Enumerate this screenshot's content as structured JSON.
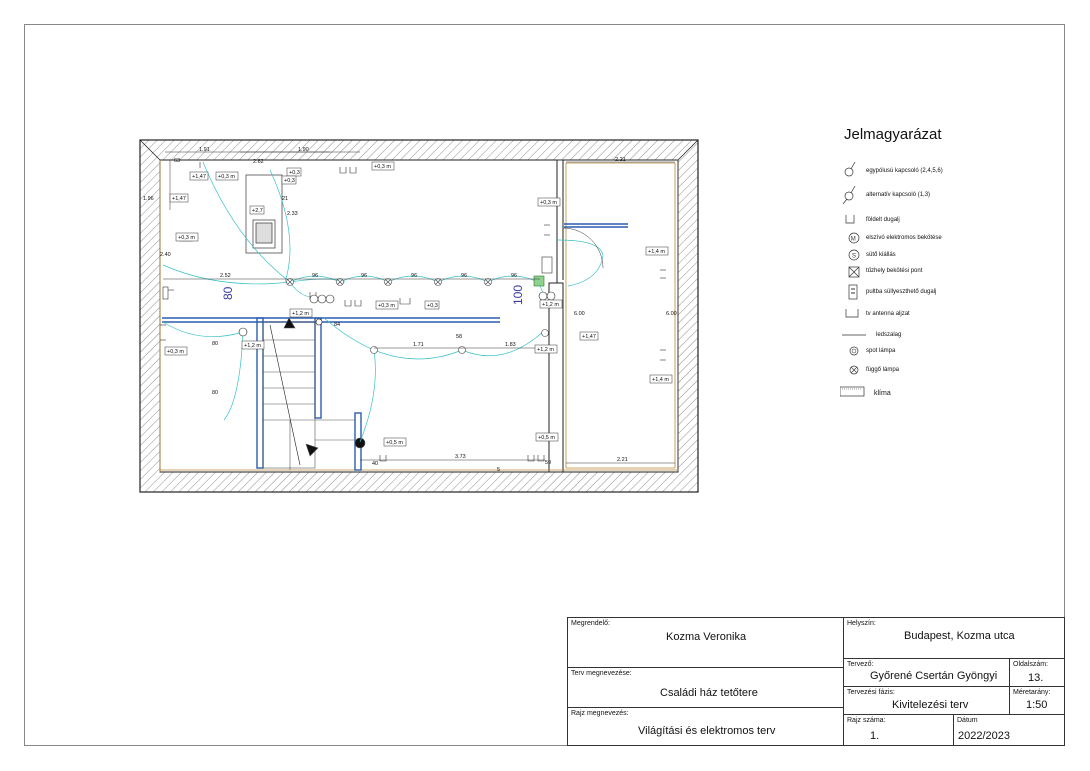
{
  "legend": {
    "title": "Jelmagyarázat",
    "items": [
      {
        "icon": "single-pole-switch-icon",
        "label": "egypólusú kapcsoló (2,4,5,6)"
      },
      {
        "icon": "alternate-switch-icon",
        "label": "alternatív kapcsoló (1,3)"
      },
      {
        "icon": "grounded-socket-icon",
        "label": "földelt dugalj"
      },
      {
        "icon": "motor-connection-icon",
        "label": "elszívó elektromos bekötése",
        "symbol_text": "M"
      },
      {
        "icon": "smoke-detector-icon",
        "label": "sütő kiállás",
        "symbol_text": "S"
      },
      {
        "icon": "fireplace-connection-icon",
        "label": "tűzhely bekötési pont"
      },
      {
        "icon": "recessed-socket-icon",
        "label": "pultba süllyeszthető dugalj"
      },
      {
        "icon": "tv-antenna-socket-icon",
        "label": "tv antenna aljzat"
      },
      {
        "icon": "ceiling-line-icon",
        "label": "ledszalag"
      },
      {
        "icon": "spot-lamp-icon",
        "label": "spot lámpa"
      },
      {
        "icon": "pendant-lamp-icon",
        "label": "függő lámpa"
      },
      {
        "icon": "air-conditioner-icon",
        "label": "klíma"
      }
    ]
  },
  "plan": {
    "room_numbers": [
      "80",
      "100"
    ],
    "dimensions": [
      "1.91",
      "1.90",
      "2.21",
      "2.52",
      "96",
      "96",
      "96",
      "96",
      "96",
      "2.33",
      "1.71",
      "1.83",
      "3.73",
      "2.21",
      "6.00",
      "6.00",
      "84",
      "80",
      "80",
      "58",
      "40",
      "59",
      "63",
      "1.96",
      "2.40",
      "2.62",
      "21",
      "5"
    ],
    "heights": [
      "+1,47",
      "+0,3 m",
      "+0,3",
      "+0,3",
      "+0,3 m",
      "+1,47",
      "+2,7",
      "+0,3 m",
      "+0,3 m",
      "+0,3 m",
      "+0,3",
      "+1,2 m",
      "+1,2 m",
      "+1,2 m",
      "+1,2 m",
      "+1,47",
      "+1,4 m",
      "+1,4 m",
      "+0,5 m",
      "+0,5 m",
      "+0,3 m"
    ]
  },
  "title_block": {
    "client_caption": "Megrendelő:",
    "client": "Kozma Veronika",
    "location_caption": "Helyszín:",
    "location": "Budapest, Kozma utca",
    "plan_name_caption": "Terv megnevezése:",
    "plan_name": "Családi ház tetőtere",
    "designer_caption": "Tervező:",
    "designer": "Győrené Csertán Gyöngyi",
    "page_caption": "Oldalszám:",
    "page": "13.",
    "phase_caption": "Tervezési fázis:",
    "phase": "Kivitelezési terv",
    "scale_caption": "Méretarány:",
    "scale": "1:50",
    "drawing_name_caption": "Rajz megnevezés:",
    "drawing_name": "Világítási és elektromos terv",
    "drawing_no_caption": "Rajz száma:",
    "drawing_no": "1.",
    "date_caption": "Dátum",
    "date": "2022/2023"
  }
}
